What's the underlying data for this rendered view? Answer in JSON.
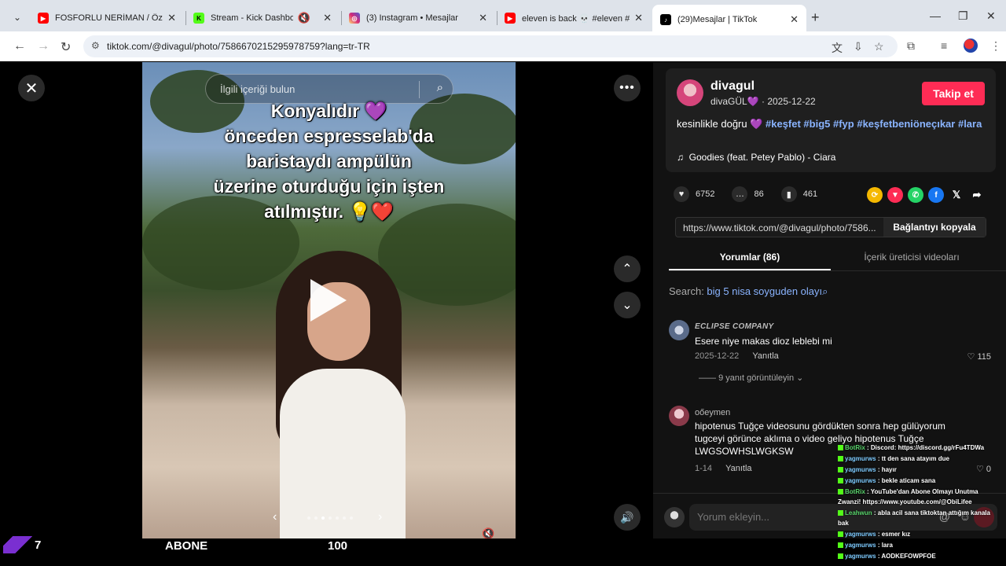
{
  "browser": {
    "tabs": [
      {
        "title": "FOSFORLU NERİMAN / Özel Ko",
        "icon": "youtube-icon",
        "color": "#ff0000"
      },
      {
        "title": "Stream - Kick Dashboard",
        "icon": "kick-icon",
        "color": "#53fc18"
      },
      {
        "title": "(3) Instagram • Mesajlar",
        "icon": "instagram-icon",
        "color": "#d6249f"
      },
      {
        "title": "eleven is back 💀 #eleven #stra",
        "icon": "youtube-icon",
        "color": "#ff0000"
      },
      {
        "title": "(29)Mesajlar | TikTok",
        "icon": "tiktok-icon",
        "color": "#000000",
        "active": true
      }
    ],
    "url": "tiktok.com/@divagul/photo/7586670215295978759?lang=tr-TR"
  },
  "viewer": {
    "search_placeholder": "İlgili içeriği bulun",
    "overlay_lines": [
      "Konyalıdır 💜",
      "önceden espresselab'da",
      "baristaydı ampülün",
      "üzerine oturduğu için işten",
      "atılmıştır. 💡❤️"
    ]
  },
  "stream_overlay": {
    "count": "7",
    "abone_label": "ABONE",
    "abone_value": "100"
  },
  "post": {
    "username": "divagul",
    "nickname": "divaGÜL💜",
    "date": "· 2025-12-22",
    "follow_label": "Takip et",
    "caption_text": "kesinlikle doğru 💜 ",
    "hashtags": "#keşfet #big5 #fyp #keşfetbeniöneçıkar #lara",
    "music": "Goodies (feat. Petey Pablo) - Ciara",
    "likes": "6752",
    "comments": "86",
    "saves": "461",
    "link": "https://www.tiktok.com/@divagul/photo/7586...",
    "copy_label": "Bağlantıyı kopyala"
  },
  "tabs": {
    "comments": "Yorumlar (86)",
    "creator_videos": "İçerik üreticisi videoları"
  },
  "search_suggestion": {
    "prefix": "Search: ",
    "query": "big 5 nisa soyguden olayı"
  },
  "comments": [
    {
      "user": "ECLIPSE COMPANY",
      "text": "Esere niye makas dioz leblebi mi",
      "date": "2025-12-22",
      "reply": "Yanıtla",
      "likes": "115",
      "view_replies": "9 yanıt görüntüleyin"
    },
    {
      "user": "oőeymen",
      "text": "hipotenus Tuğçe videosunu gördükten sonra hep gülüyorum tugceyi görünce aklıma o video geliyo hipotenus Tuğçe LWGSOWHSLWGKSW",
      "date": "1-14",
      "reply": "Yanıtla",
      "likes": "0"
    }
  ],
  "comment_input": {
    "placeholder": "Yorum ekleyin..."
  },
  "chat": [
    {
      "user": "BotRix",
      "msg": ": Discord: https://discord.gg/rFu4TDWa",
      "bot": true
    },
    {
      "user": "yagmurws",
      "msg": ": tt den sana atayım due"
    },
    {
      "user": "yagmurws",
      "msg": ": hayır"
    },
    {
      "user": "yagmurws",
      "msg": ": bekle aticam sana"
    },
    {
      "user": "BotRix",
      "msg": ": YouTube'dan Abone Olmayı Unutma",
      "bot": true
    },
    {
      "user": "",
      "msg": "Zwanzi! https://www.youtube.com/@ObiLifee"
    },
    {
      "user": "Leahwun",
      "msg": ": abla acil sana tiktoktan attığım kanala",
      "bot": true
    },
    {
      "user": "",
      "msg": "bak"
    },
    {
      "user": "yagmurws",
      "msg": ": esmer kız"
    },
    {
      "user": "yagmurws",
      "msg": ": lara"
    },
    {
      "user": "yagmurws",
      "msg": ": AODKEFOWPFOE"
    }
  ]
}
